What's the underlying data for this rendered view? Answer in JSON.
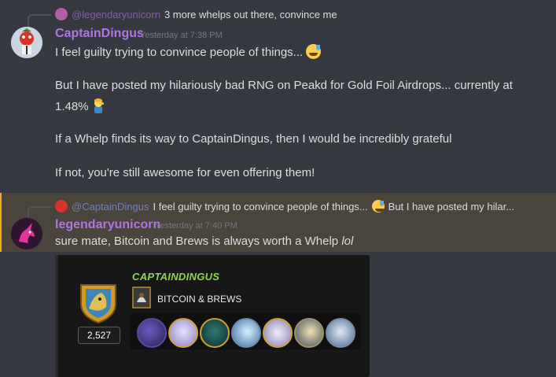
{
  "reply1": {
    "mention": "@legendaryunicorn",
    "text": "3 more whelps out there, convince me"
  },
  "message1": {
    "username": "CaptainDingus",
    "timestamp": "Yesterday at 7:38 PM",
    "lines": [
      "I feel guilty trying to convince people of things...",
      "But I have posted my hilariously bad RNG on Peakd for Gold Foil Airdrops... currently at",
      "1.48%",
      "If a Whelp finds its way to CaptainDingus, then I would be incredibly grateful",
      "If not, you're still awesome for even offering them!"
    ]
  },
  "reply2": {
    "mention": "@CaptainDingus",
    "text_a": "I feel guilty trying to convince people of things...",
    "text_b": "But I have posted my hilar..."
  },
  "message2": {
    "username": "legendaryunicorn",
    "timestamp": "Yesterday at 7:40 PM",
    "text": "sure mate, Bitcoin and Brews is always worth a Whelp",
    "text_italic": "lol"
  },
  "card": {
    "player_name": "CAPTAINDINGUS",
    "guild": "BITCOIN & BREWS",
    "rating": "2,527"
  },
  "colors": {
    "background": "#36393f",
    "username": "#b374e6",
    "highlight": "#49443c",
    "highlight_bar": "#faa61a",
    "player_name": "#8fd44a"
  }
}
